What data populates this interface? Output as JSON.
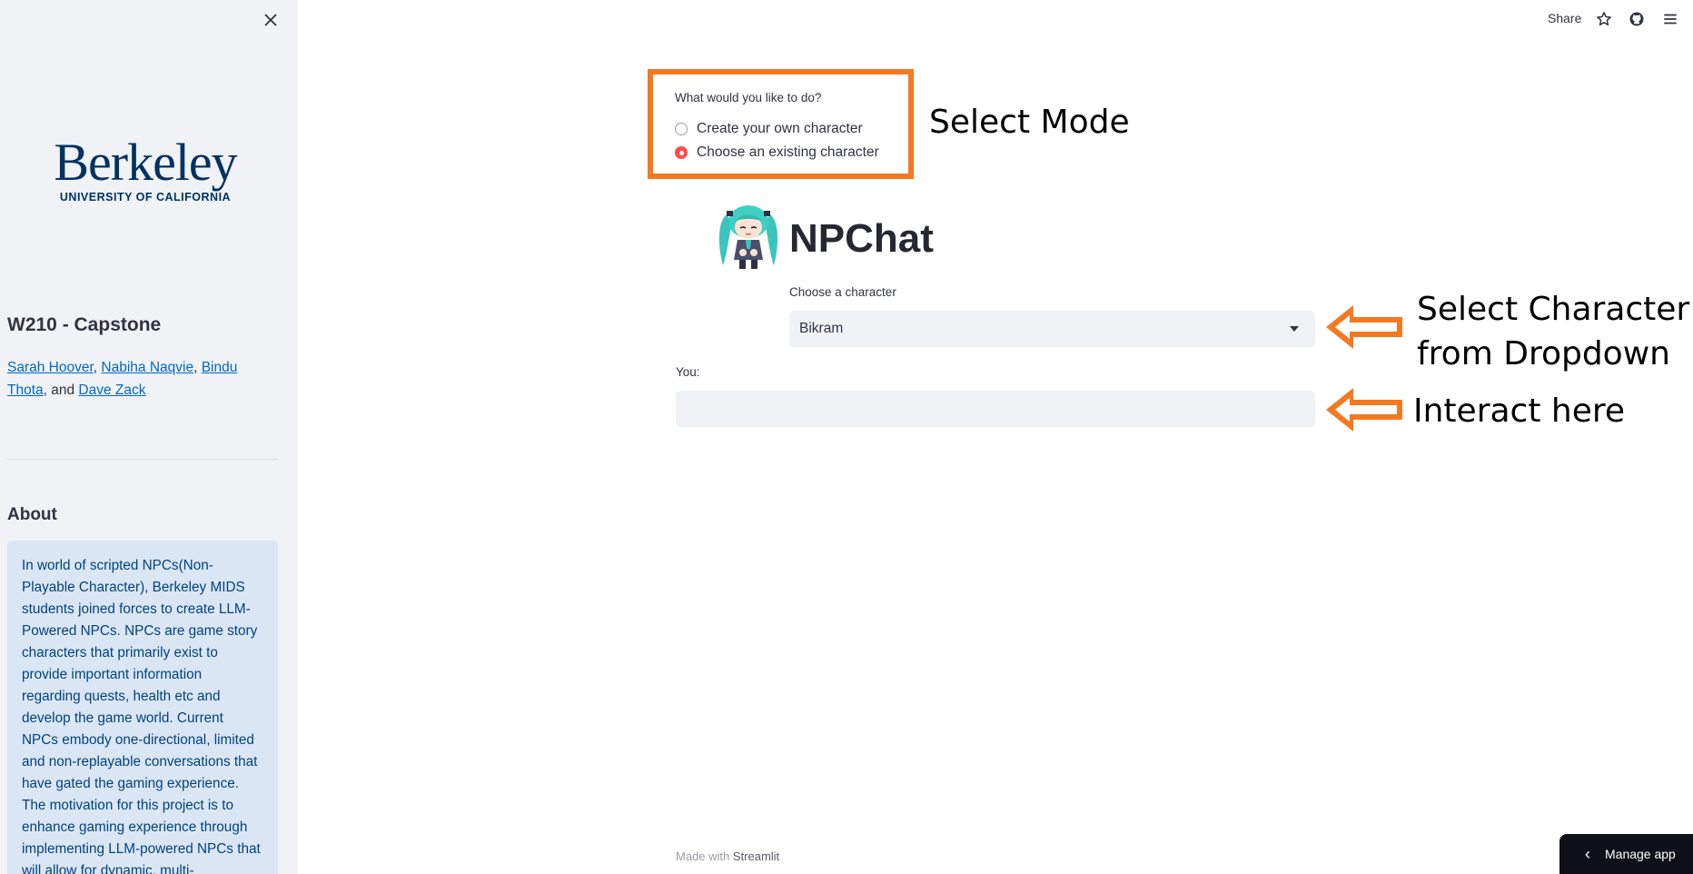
{
  "sidebar": {
    "close_icon": "close-icon",
    "logo": {
      "wordmark": "Berkeley",
      "subtitle": "UNIVERSITY OF CALIFORNIA",
      "color": "#003262"
    },
    "title": "W210 - Capstone",
    "authors": [
      {
        "name": "Sarah Hoover",
        "sep": ", "
      },
      {
        "name": "Nabiha Naqvie",
        "sep": ", "
      },
      {
        "name": "Bindu Thota",
        "sep": ", and "
      },
      {
        "name": "Dave Zack",
        "sep": ""
      }
    ],
    "about_title": "About",
    "about_text": "In world of scripted NPCs(Non-Playable Character), Berkeley MIDS students joined forces to create LLM-Powered NPCs. NPCs are game story characters that primarily exist to provide important information regarding quests, health etc and develop the game world. Current NPCs embody one-directional, limited and non-replayable conversations that have gated the gaming experience. The motivation for this project is to enhance gaming experience through implementing LLM-powered NPCs that will allow for dynamic, multi-"
  },
  "toolbar": {
    "share_label": "Share",
    "icons": [
      "star-icon",
      "github-icon",
      "menu-icon"
    ]
  },
  "mode": {
    "label": "What would you like to do?",
    "options": [
      "Create your own character",
      "Choose an existing character"
    ],
    "selected_index": 1,
    "annotation": "Select Mode"
  },
  "app": {
    "title": "NPChat",
    "avatar_icon": "chibi-avatar-icon"
  },
  "character_select": {
    "label": "Choose a character",
    "value": "Bikram",
    "annotation_line1": "Select Character",
    "annotation_line2": "from Dropdown"
  },
  "chat_input": {
    "label": "You:",
    "value": "",
    "placeholder": "",
    "annotation": "Interact here"
  },
  "footer": {
    "prefix": "Made with ",
    "brand": "Streamlit"
  },
  "manage_app": {
    "label": "Manage app",
    "icon": "chevron-left-icon"
  },
  "colors": {
    "annotation_orange": "#f47920",
    "accent_red": "#ff4b4b",
    "about_bg": "#dbe6f4",
    "sidebar_bg": "#f0f2f6"
  }
}
